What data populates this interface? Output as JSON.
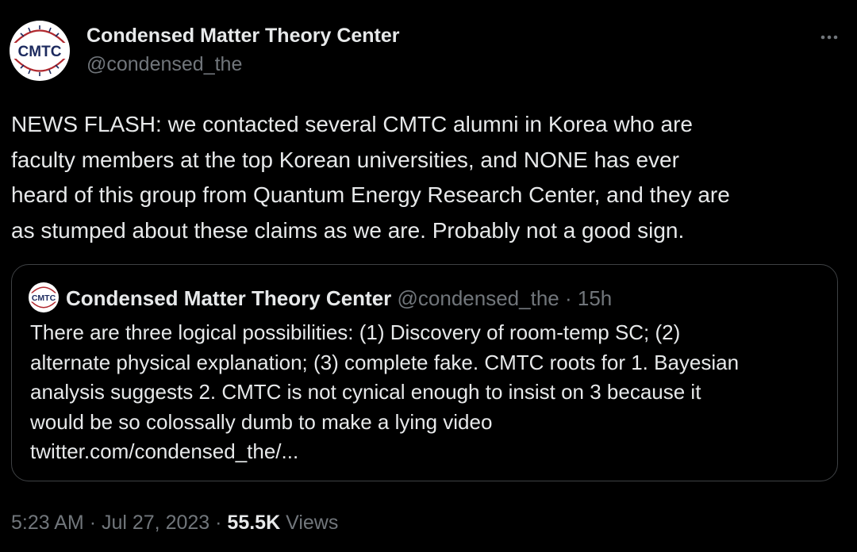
{
  "tweet": {
    "author": {
      "display_name": "Condensed Matter Theory Center",
      "handle": "@condensed_the",
      "avatar_text": "CMTC"
    },
    "text_lines": [
      "NEWS FLASH:  we contacted several CMTC alumni in Korea who are",
      "faculty members at the top Korean universities, and NONE has ever",
      "heard of this group from Quantum Energy Research Center, and they are",
      "as stumped about these claims as we are.  Probably not a good sign."
    ],
    "more_icon": "more-horizontal-icon",
    "quote": {
      "display_name": "Condensed Matter Theory Center",
      "handle": "@condensed_the",
      "separator": "·",
      "time_ago": "15h",
      "avatar_text": "CMTC",
      "text_lines": [
        "There are three logical possibilities: (1) Discovery of room-temp SC; (2)",
        "alternate physical explanation; (3) complete fake.  CMTC roots for 1.  Bayesian",
        "analysis suggests 2. CMTC is not cynical enough to insist on 3 because it",
        "would be so colossally dumb to make a lying video",
        "twitter.com/condensed_the/..."
      ]
    },
    "footer": {
      "time": "5:23 AM",
      "separator_1": "·",
      "date": "Jul 27, 2023",
      "separator_2": "·",
      "views_count": "55.5K",
      "views_label": "Views"
    }
  },
  "colors": {
    "background": "#000000",
    "primary_text": "#e7e9ea",
    "secondary_text": "#71767b",
    "quote_border": "#3e4144",
    "logo_red": "#b0282e",
    "logo_navy": "#1c2a5e"
  }
}
